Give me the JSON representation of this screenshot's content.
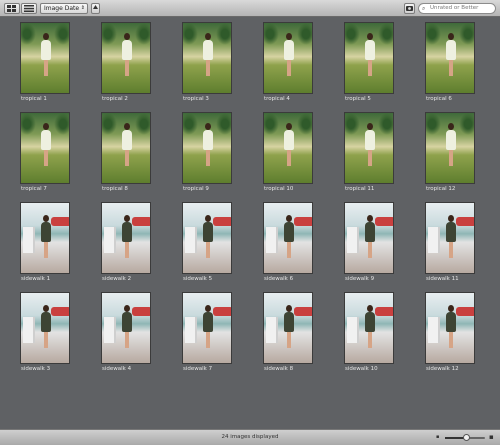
{
  "toolbar": {
    "sort_select": "Image Date",
    "sort_chevron": "⇕",
    "search_placeholder": "Unrated or Better",
    "search_icon": "magnifier-icon"
  },
  "images": [
    {
      "label": "tropical 1",
      "set": "tropical"
    },
    {
      "label": "tropical 2",
      "set": "tropical"
    },
    {
      "label": "tropical 3",
      "set": "tropical"
    },
    {
      "label": "tropical 4",
      "set": "tropical"
    },
    {
      "label": "tropical 5",
      "set": "tropical"
    },
    {
      "label": "tropical 6",
      "set": "tropical"
    },
    {
      "label": "tropical 7",
      "set": "tropical"
    },
    {
      "label": "tropical 8",
      "set": "tropical"
    },
    {
      "label": "tropical 9",
      "set": "tropical"
    },
    {
      "label": "tropical 10",
      "set": "tropical"
    },
    {
      "label": "tropical 11",
      "set": "tropical"
    },
    {
      "label": "tropical 12",
      "set": "tropical"
    },
    {
      "label": "sidewalk 1",
      "set": "sidewalk"
    },
    {
      "label": "sidewalk 2",
      "set": "sidewalk"
    },
    {
      "label": "sidewalk 5",
      "set": "sidewalk"
    },
    {
      "label": "sidewalk 6",
      "set": "sidewalk"
    },
    {
      "label": "sidewalk 9",
      "set": "sidewalk"
    },
    {
      "label": "sidewalk 11",
      "set": "sidewalk"
    },
    {
      "label": "sidewalk 3",
      "set": "sidewalk"
    },
    {
      "label": "sidewalk 4",
      "set": "sidewalk"
    },
    {
      "label": "sidewalk 7",
      "set": "sidewalk"
    },
    {
      "label": "sidewalk 8",
      "set": "sidewalk"
    },
    {
      "label": "sidewalk 10",
      "set": "sidewalk"
    },
    {
      "label": "sidewalk 12",
      "set": "sidewalk"
    }
  ],
  "status": {
    "text": "24 images displayed",
    "zoom_level": 0.55
  },
  "colors": {
    "background": "#5f6164",
    "caption": "#e6e6e6"
  }
}
